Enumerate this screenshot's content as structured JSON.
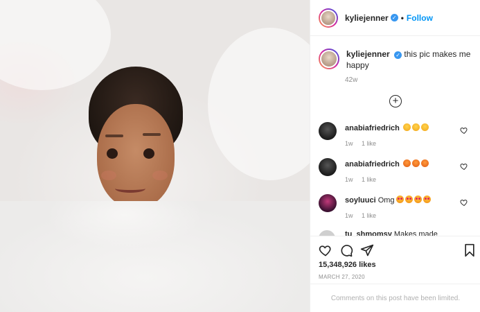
{
  "post": {
    "username": "kyliejenner",
    "follow_label": "Follow",
    "dot": "•",
    "verified_mark": "✓",
    "caption_text": "this pic makes me happy",
    "caption_time": "42w",
    "load_more_symbol": "+"
  },
  "comments": [
    {
      "username": "anabiafriedrich",
      "text": "",
      "emoji": [
        "grinning-face",
        "grinning-face",
        "grinning-face"
      ],
      "time": "1w",
      "likes": "1 like"
    },
    {
      "username": "anabiafriedrich",
      "text": "",
      "emoji": [
        "fox-face",
        "fox-face",
        "fox-face"
      ],
      "time": "1w",
      "likes": "1 like"
    },
    {
      "username": "soyluuci",
      "text": "Omg",
      "emoji": [
        "heart-eyes-face",
        "heart-eyes-face",
        "heart-eyes-face",
        "heart-eyes-face"
      ],
      "time": "1w",
      "likes": "1 like"
    }
  ],
  "partial_comment": {
    "username": "tu_shmomsy",
    "text": "Makes made"
  },
  "actions": {
    "icons": [
      "heart-icon",
      "comment-icon",
      "share-icon",
      "bookmark-icon"
    ],
    "likes_count": "15,348,926 likes",
    "date": "MARCH 27, 2020",
    "comments_limited": "Comments on this post have been limited."
  },
  "colors": {
    "link_blue": "#0095f6",
    "verified_blue": "#3897f0",
    "text_primary": "#262626",
    "text_secondary": "#8e8e8e"
  }
}
